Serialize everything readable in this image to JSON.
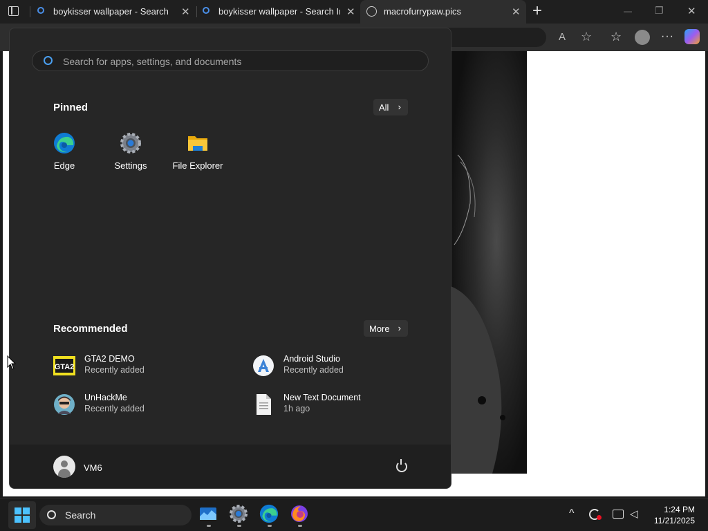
{
  "browser": {
    "tabs": [
      {
        "title": "boykisser wallpaper - Search",
        "icon": "search-icon"
      },
      {
        "title": "boykisser wallpaper - Search Imag",
        "icon": "search-icon"
      },
      {
        "title": "macrofurrypaw.pics",
        "icon": "globe-icon"
      }
    ],
    "close_glyph": "✕",
    "new_tab_glyph": "+",
    "window_controls": {
      "minimize": "—",
      "restore": "❐",
      "close": "✕"
    }
  },
  "start_menu": {
    "search_placeholder": "Search for apps, settings, and documents",
    "pinned": {
      "title": "Pinned",
      "all_label": "All",
      "apps": [
        {
          "label": "Edge",
          "icon": "edge-icon"
        },
        {
          "label": "Settings",
          "icon": "settings-icon"
        },
        {
          "label": "File Explorer",
          "icon": "file-explorer-icon"
        }
      ]
    },
    "recommended": {
      "title": "Recommended",
      "more_label": "More",
      "items": [
        {
          "name": "GTA2 DEMO",
          "sub": "Recently added",
          "icon": "gta2-icon"
        },
        {
          "name": "Android Studio",
          "sub": "Recently added",
          "icon": "android-studio-icon"
        },
        {
          "name": "UnHackMe",
          "sub": "Recently added",
          "icon": "unhackme-icon"
        },
        {
          "name": "New Text Document",
          "sub": "1h ago",
          "icon": "text-document-icon"
        }
      ]
    },
    "user": {
      "name": "VM6"
    },
    "chevron_glyph": "›"
  },
  "taskbar": {
    "search_label": "Search",
    "time": "1:24 PM",
    "date": "11/21/2025",
    "tray_chevron": "^"
  },
  "colors": {
    "accent": "#0078d4",
    "start_bg": "#262626",
    "taskbar_bg": "#1c1c1c"
  }
}
